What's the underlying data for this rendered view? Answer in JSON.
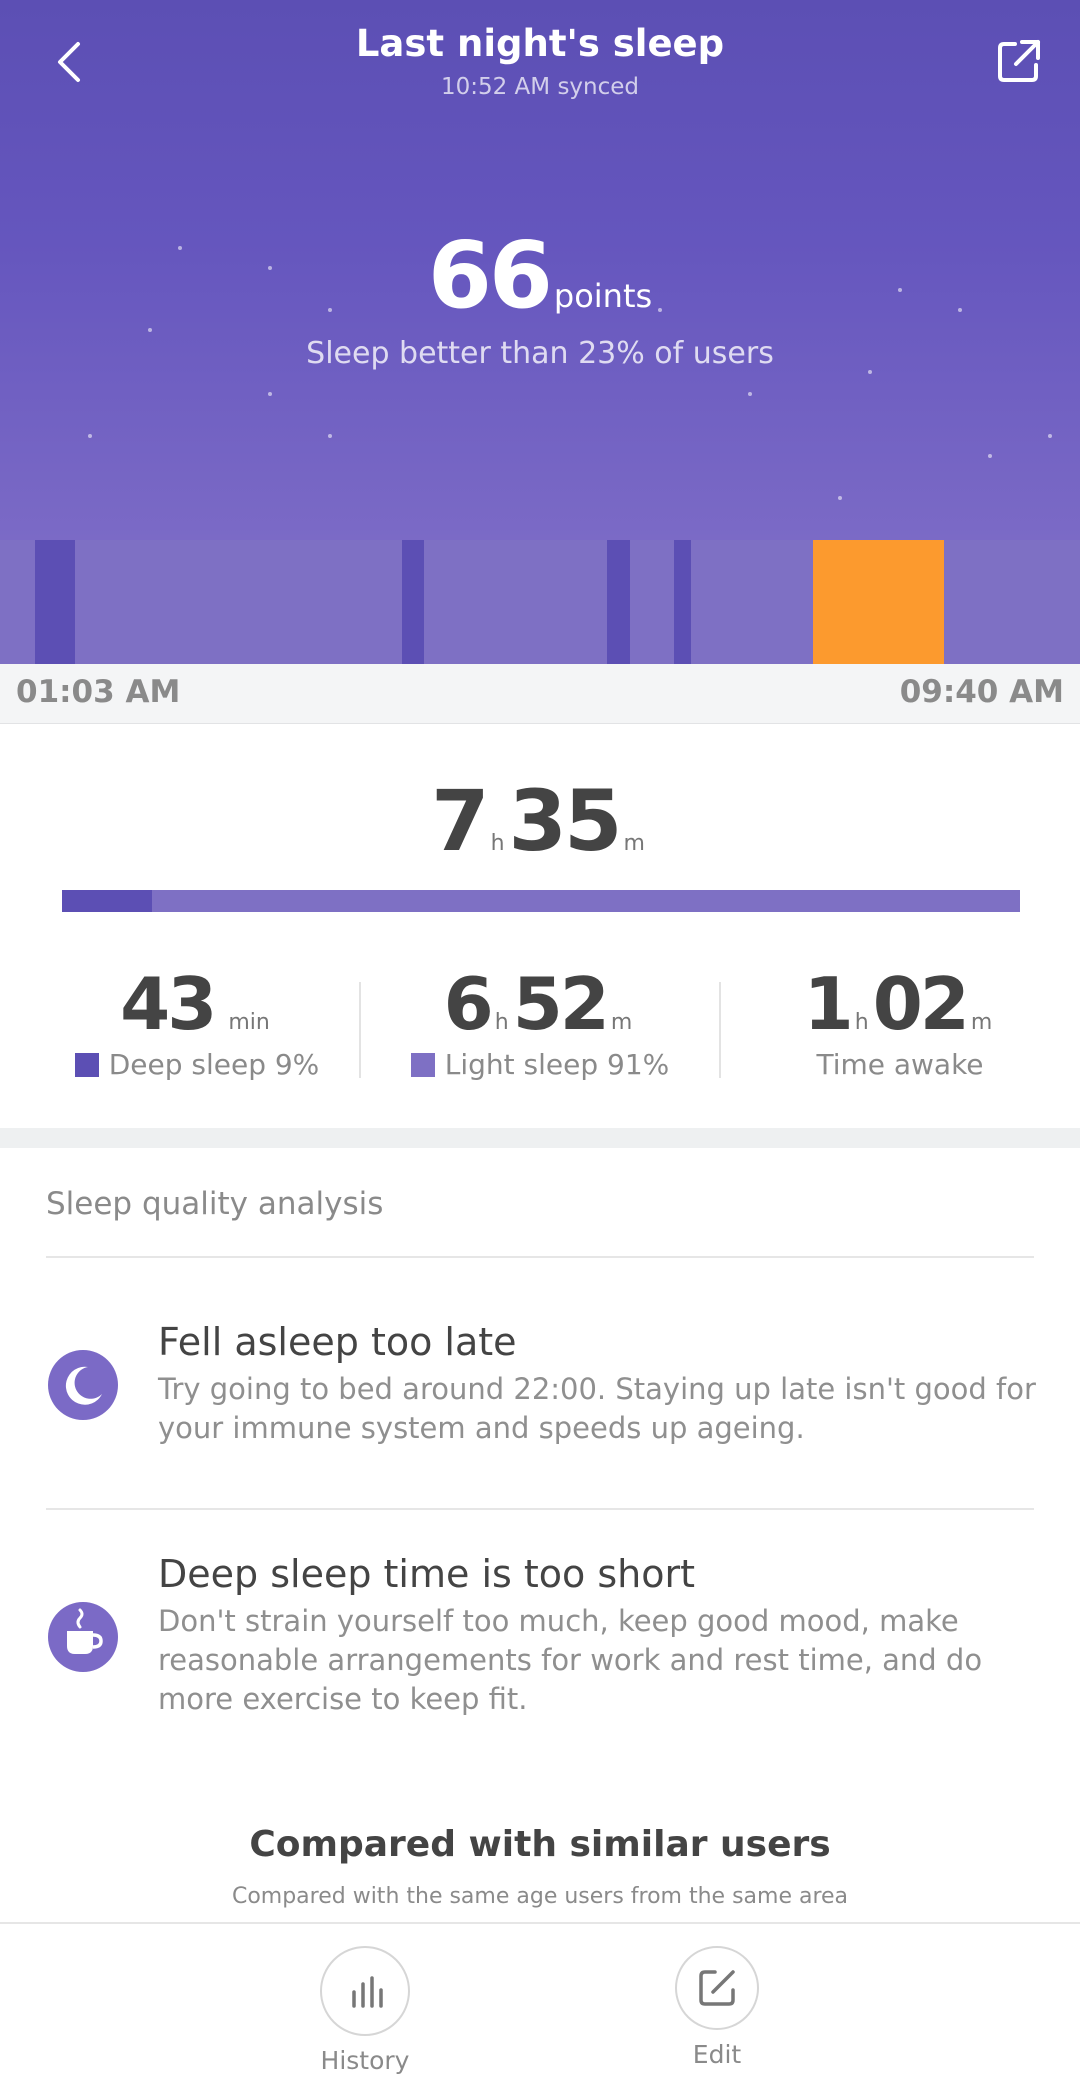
{
  "header": {
    "title": "Last night's sleep",
    "synced": "10:52 AM synced",
    "back_icon": "chevron-left-icon",
    "share_icon": "share-external-icon"
  },
  "score": {
    "value": "66",
    "unit": "points",
    "description": "Sleep better than 23% of users"
  },
  "timeline": {
    "start": "01:03 AM",
    "end": "09:40 AM",
    "colors": {
      "light": "#7e70c4",
      "deep": "#5c4fb4",
      "awake": "#fc9a2e"
    },
    "segments": [
      {
        "type": "deep",
        "start": 0.032,
        "end": 0.069
      },
      {
        "type": "deep",
        "start": 0.372,
        "end": 0.392
      },
      {
        "type": "deep",
        "start": 0.562,
        "end": 0.583
      },
      {
        "type": "deep",
        "start": 0.624,
        "end": 0.64
      },
      {
        "type": "awake",
        "start": 0.753,
        "end": 0.874
      }
    ]
  },
  "total": {
    "hours": "7",
    "hours_unit": "h",
    "minutes": "35",
    "minutes_unit": "m",
    "deep_fraction": 0.094
  },
  "stats": {
    "deep": {
      "value": "43",
      "unit": "min",
      "label": "Deep sleep 9%"
    },
    "light": {
      "hours": "6",
      "hours_unit": "h",
      "minutes": "52",
      "minutes_unit": "m",
      "label": "Light sleep 91%"
    },
    "awake": {
      "hours": "1",
      "hours_unit": "h",
      "minutes": "02",
      "minutes_unit": "m",
      "label": "Time awake"
    }
  },
  "analysis": {
    "title": "Sleep quality analysis",
    "items": [
      {
        "icon": "moon-icon",
        "title": "Fell asleep too late",
        "body": "Try going to bed around 22:00. Staying up late isn't good for your immune system and speeds up ageing."
      },
      {
        "icon": "coffee-cup-icon",
        "title": "Deep sleep time is too short",
        "body": "Don't strain yourself too much, keep good mood, make reasonable arrangements for work and rest time, and do more exercise to keep fit."
      }
    ]
  },
  "compare": {
    "title": "Compared with similar users",
    "subtitle": "Compared with the same age users from the same area"
  },
  "bottom": {
    "history_label": "History",
    "history_icon": "bar-chart-icon",
    "edit_label": "Edit",
    "edit_icon": "edit-icon"
  }
}
